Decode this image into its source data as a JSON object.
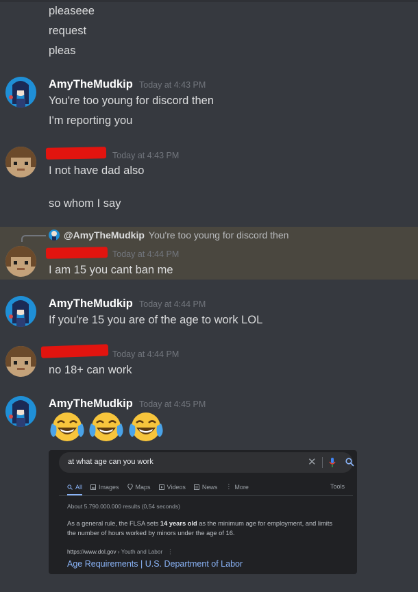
{
  "continued_lines": [
    "pleaseee",
    "request",
    "pleas"
  ],
  "messages": [
    {
      "author": "AmyTheMudkip",
      "timestamp": "Today at 4:43 PM",
      "lines": [
        "You're too young for discord then",
        "I'm reporting you"
      ]
    },
    {
      "author": "",
      "timestamp": "Today at 4:43 PM",
      "lines": [
        "I not have dad also",
        "so whom I say"
      ]
    },
    {
      "reply": {
        "author": "@AmyTheMudkip",
        "text": "You're too young for discord then"
      },
      "author": "",
      "timestamp": "Today at 4:44 PM",
      "lines": [
        "I am 15 you cant ban me"
      ]
    },
    {
      "author": "AmyTheMudkip",
      "timestamp": "Today at 4:44 PM",
      "lines": [
        "If you're 15 you are of the age to work LOL"
      ]
    },
    {
      "author": "",
      "timestamp": "Today at 4:44 PM",
      "lines": [
        "no 18+ can work"
      ]
    },
    {
      "author": "AmyTheMudkip",
      "timestamp": "Today at 4:45 PM",
      "emoji": [
        "face-with-tears-of-joy",
        "face-with-tears-of-joy",
        "face-with-tears-of-joy"
      ]
    }
  ],
  "google": {
    "query": "at what age can you work",
    "tabs": [
      "All",
      "Images",
      "Maps",
      "Videos",
      "News",
      "More"
    ],
    "tools": "Tools",
    "count": "About 5.790.000.000 results (0,54 seconds)",
    "snippet_pre": "As a general rule, the FLSA sets ",
    "snippet_bold": "14 years old",
    "snippet_post": " as the minimum age for employment, and limits the number of hours worked by minors under the age of 16.",
    "url_domain": "https://www.dol.gov",
    "url_path": " › Youth and Labor",
    "result_title": "Age Requirements | U.S. Department of Labor"
  },
  "colors": {
    "background": "#36393f",
    "highlight": "#4a473f",
    "redaction": "#e2140f",
    "link": "#8ab4f8"
  }
}
